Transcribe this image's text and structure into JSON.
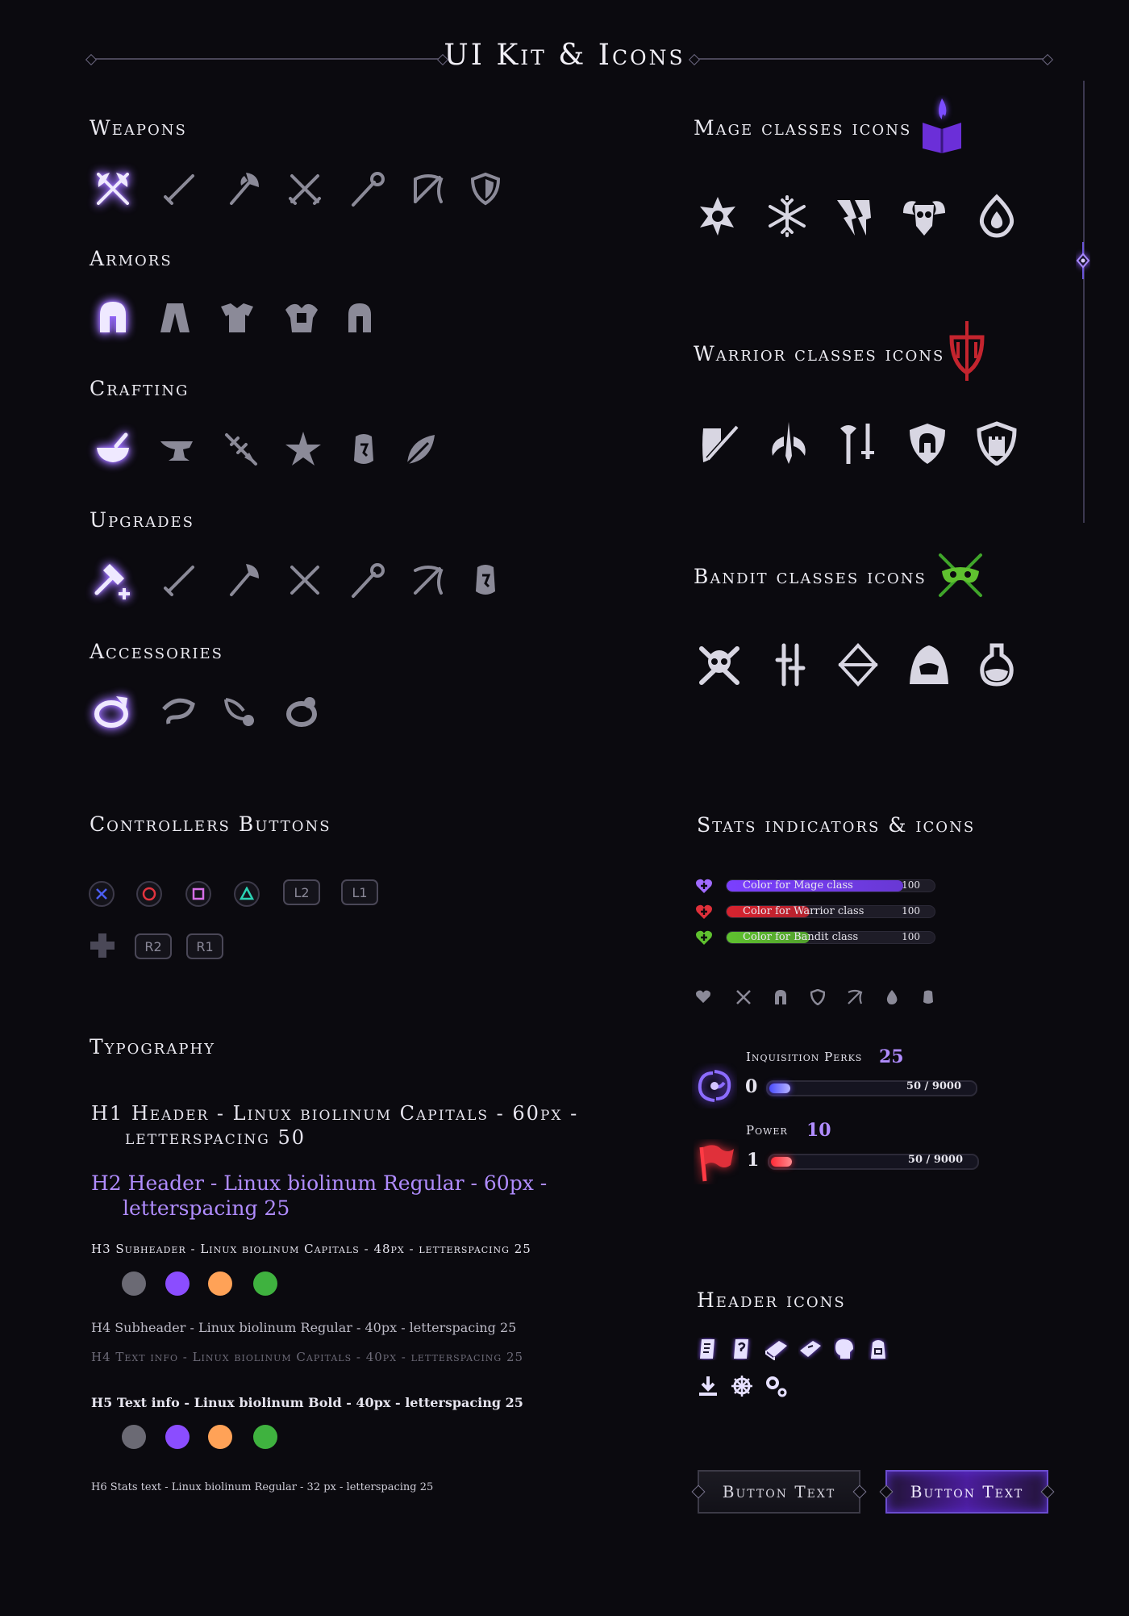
{
  "page_title": "UI Kit & Icons",
  "sections": {
    "weapons": "Weapons",
    "armors": "Armors",
    "crafting": "Crafting",
    "upgrades": "Upgrades",
    "accessories": "Accessories",
    "mage": "Mage classes icons",
    "warrior": "Warrior classes icons",
    "bandit": "Bandit classes icons",
    "controllers": "Controllers Buttons",
    "stats": "Stats indicators & icons",
    "typography": "Typography",
    "header_icons": "Header icons"
  },
  "icons": {
    "weapons": [
      "crossed-axes-icon",
      "sword-icon",
      "axe-icon",
      "crossed-swords-icon",
      "staff-icon",
      "bow-icon",
      "shield-icon"
    ],
    "armors": [
      "helmet-icon",
      "robe-icon",
      "chestplate-icon",
      "heavy-armor-icon",
      "knight-helmet-icon"
    ],
    "crafting": [
      "mortar-icon",
      "anvil-icon",
      "fletching-icon",
      "herb-star-icon",
      "rune-stone-icon",
      "leaf-icon"
    ],
    "upgrades": [
      "hammer-plus-icon",
      "sword-icon",
      "axe-icon",
      "crossed-swords-icon",
      "staff-icon",
      "bow-icon",
      "rune-stone-icon"
    ],
    "accessories": [
      "ring-icon",
      "amulet-icon",
      "necklace-icon",
      "gem-ring-icon"
    ],
    "mage": [
      "fire-flower-icon",
      "snowflake-icon",
      "lightning-claw-icon",
      "ram-skull-icon",
      "flame-drop-icon"
    ],
    "warrior": [
      "sword-shield-icon",
      "sword-wings-icon",
      "axe-sword-icon",
      "helmet-shield-icon",
      "castle-shield-icon"
    ],
    "bandit": [
      "skull-crossbones-icon",
      "daggers-icon",
      "bow-arrow-icon",
      "hood-icon",
      "potion-icon"
    ]
  },
  "controllers": {
    "face": [
      "cross-button",
      "circle-button",
      "square-button",
      "triangle-button"
    ],
    "l2": "L2",
    "l1": "L1",
    "r2": "R2",
    "r1": "R1"
  },
  "typography": {
    "h1": "H1 Header - Linux biolinum Capitals - 60px -",
    "h1b": "letterspacing 50",
    "h2": "H2 Header - Linux biolinum Regular - 60px -",
    "h2b": "letterspacing 25",
    "h3": "H3   Subheader - Linux biolinum Capitals - 48px - letterspacing 25",
    "h4a": "H4   Subheader - Linux biolinum Regular - 40px - letterspacing 25",
    "h4b": "H4   Text info - Linux biolinum Capitals - 40px - letterspacing 25",
    "h5": "H5   Text info - Linux biolinum Bold - 40px - letterspacing 25",
    "h6": "H6   Stats text - Linux biolinum Regular - 32 px - letterspacing 25",
    "colors": [
      "#6b6a74",
      "#8b4dff",
      "#ffa257",
      "#3fb23f"
    ]
  },
  "stats": {
    "bars": [
      {
        "label": "Color for Mage class",
        "value": "100",
        "color": "#7b3fff",
        "fill": 0.85
      },
      {
        "label": "Color for Warrior class",
        "value": "100",
        "color": "#d8232f",
        "fill": 0.4
      },
      {
        "label": "Color for Bandit class",
        "value": "100",
        "color": "#5fc12f",
        "fill": 0.4
      }
    ],
    "small_icons": [
      "heart-plus-icon",
      "crossed-swords-icon",
      "helmet-icon",
      "shield-icon",
      "bow-icon",
      "flame-icon",
      "rune-stone-icon"
    ],
    "perks_label": "Inquisition Perks",
    "perks_points": "25",
    "perks_level": "0",
    "perks_bar": "50 / 9000",
    "perks_fill": 0.1,
    "power_label": "Power",
    "power_points": "10",
    "power_level": "1",
    "power_bar": "50 / 9000",
    "power_fill": 0.1
  },
  "header_icons": [
    "scroll-icon",
    "scroll-quest-icon",
    "book-icon",
    "spellbook-icon",
    "head-icon",
    "backpack-icon",
    "download-icon",
    "gear-wheel-icon",
    "settings-gears-icon"
  ],
  "buttons": {
    "normal": "Button Text",
    "active": "Button Text"
  },
  "accent_colors": {
    "mage": "#8c5cff",
    "warrior": "#d8232f",
    "bandit": "#5fc12f"
  }
}
